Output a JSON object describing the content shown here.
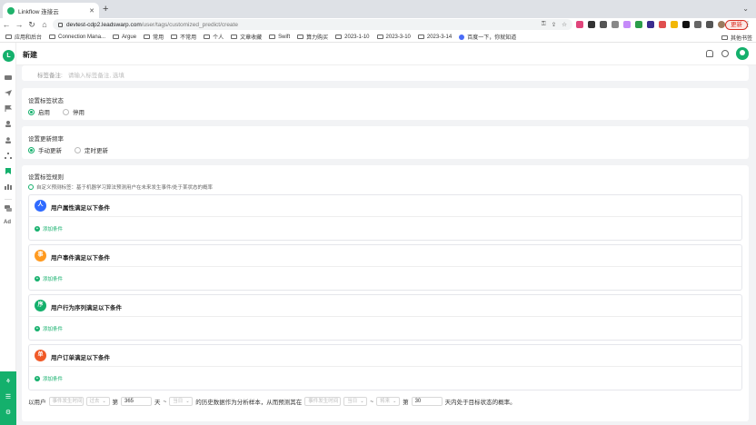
{
  "browser": {
    "tab_title": "Linkflow 连接云",
    "new_tab": "+",
    "url_host": "devtest-cdp2.leadswarp.com",
    "url_path": "/user/tags/customized_predict/create",
    "update_label": "更新",
    "bookmarks": [
      "应用和后台",
      "Connection Mana...",
      "Argue",
      "常用",
      "不常用",
      "个人",
      "文章收藏",
      "Swift",
      "算力购买",
      "2023-1-10",
      "2023-3-10",
      "2023-3-14",
      "百度一下，你就知道"
    ],
    "bookmarks_other": "其他书签"
  },
  "app": {
    "logo_text": "L",
    "page_title": "新建",
    "sidebar_ad": "Ad"
  },
  "remark": {
    "label": "标签备注:",
    "placeholder": "请输入标签备注, 选填"
  },
  "status": {
    "label": "设置标签状态",
    "options": [
      "启用",
      "停用"
    ],
    "selected": "启用"
  },
  "frequency": {
    "label": "设置更新频率",
    "options": [
      "手动更新",
      "定时更新"
    ],
    "selected": "手动更新"
  },
  "rules": {
    "label": "设置标签规则",
    "hint": "自定义预测标签：基于机器学习算法预测用户在未来发生事件/处于某状态的概率",
    "conditions": [
      {
        "title": "用户属性满足以下条件",
        "icon": "person-icon",
        "color": "#2f6bff",
        "glyph": "人",
        "add": "添加条件"
      },
      {
        "title": "用户事件满足以下条件",
        "icon": "event-icon",
        "color": "#ff9a1f",
        "glyph": "事",
        "add": "添加条件"
      },
      {
        "title": "用户行为序列满足以下条件",
        "icon": "sequence-icon",
        "color": "#14b06c",
        "glyph": "序",
        "add": "添加条件"
      },
      {
        "title": "用户订单满足以下条件",
        "icon": "order-icon",
        "color": "#f05a28",
        "glyph": "单",
        "add": "添加条件"
      }
    ]
  },
  "sentence": {
    "prefix": "以用户",
    "event_time_placeholder": "事件发生时间",
    "past_placeholder": "过去",
    "di": "第",
    "days_value": "365",
    "day_unit": "天",
    "tilde": "~",
    "today_placeholder": "当日",
    "middle_text": "的历史数据作为分析样本，从而预测其在",
    "event_time_placeholder_2": "事件发生时间",
    "today_placeholder_2": "当日",
    "future_placeholder": "将来",
    "di_2": "第",
    "future_days_value": "30",
    "suffix": "天内处于目标状态的概率。"
  },
  "colors": {
    "brand": "#14b06c"
  }
}
